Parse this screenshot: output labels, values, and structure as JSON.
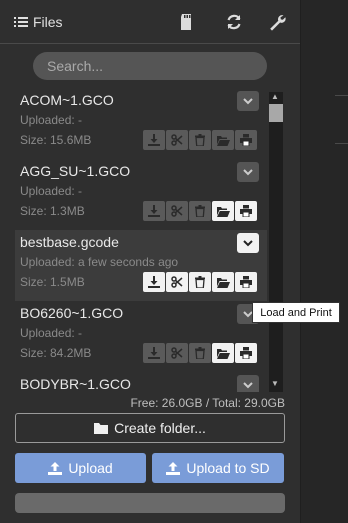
{
  "header": {
    "title": "Files"
  },
  "search": {
    "placeholder": "Search..."
  },
  "files": [
    {
      "name": "ACOM~1.GCO",
      "uploaded": "Uploaded: -",
      "size": "Size: 15.6MB",
      "active": false
    },
    {
      "name": "AGG_SU~1.GCO",
      "uploaded": "Uploaded: -",
      "size": "Size: 1.3MB",
      "active": false
    },
    {
      "name": "bestbase.gcode",
      "uploaded": "Uploaded: a few seconds ago",
      "size": "Size: 1.5MB",
      "active": true
    },
    {
      "name": "BO6260~1.GCO",
      "uploaded": "Uploaded: -",
      "size": "Size: 84.2MB",
      "active": false
    },
    {
      "name": "BODYBR~1.GCO",
      "uploaded": "",
      "size": "",
      "active": false
    }
  ],
  "storage": {
    "text": "Free: 26.0GB / Total: 29.0GB"
  },
  "actions": {
    "create_folder": "Create folder...",
    "upload": "Upload",
    "upload_sd": "Upload to SD"
  },
  "tooltip": {
    "text": "Load and Print"
  },
  "colors": {
    "accent": "#7a9cd8",
    "panel": "#2f2f2f"
  }
}
